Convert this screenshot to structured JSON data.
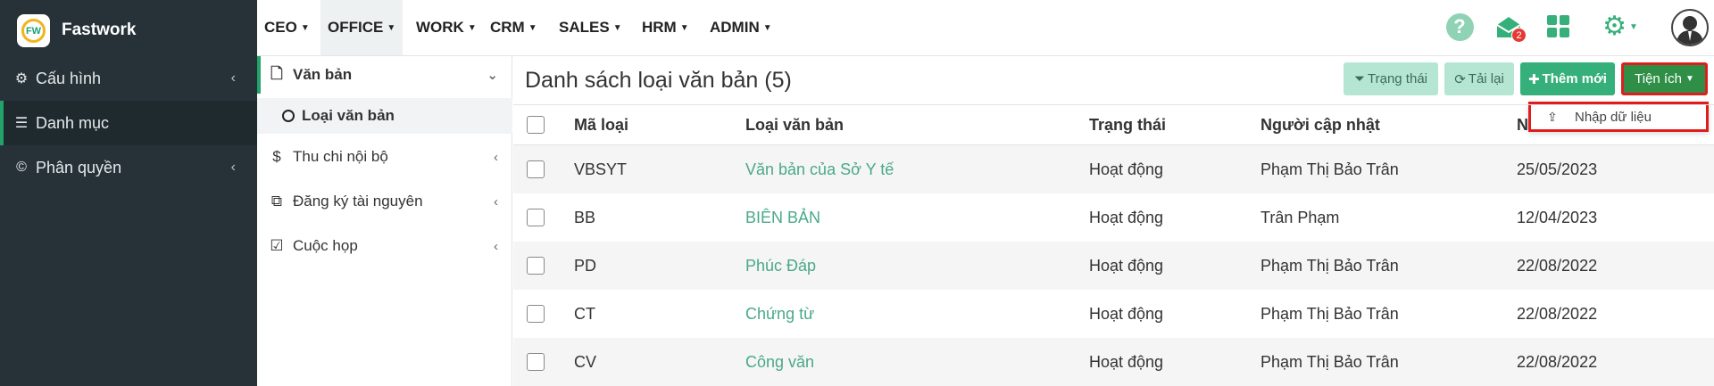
{
  "brand": {
    "name": "Fastwork",
    "logo_text": "FW"
  },
  "sidebar": {
    "items": [
      {
        "label": "Cấu hình",
        "icon": "gear-icon",
        "chevron": "‹"
      },
      {
        "label": "Danh mục",
        "icon": "list-icon"
      },
      {
        "label": "Phân quyền",
        "icon": "copyright-icon",
        "chevron": "‹"
      }
    ]
  },
  "topnav": {
    "items": [
      "CEO",
      "OFFICE",
      "WORK",
      "CRM",
      "SALES",
      "HRM",
      "ADMIN"
    ],
    "active": "OFFICE",
    "notification_count": "2"
  },
  "subnav": {
    "items": [
      {
        "label": "Văn bản",
        "icon": "document-icon"
      },
      {
        "label": "Loại văn bản"
      },
      {
        "label": "Thu chi nội bộ",
        "icon": "dollar-icon"
      },
      {
        "label": "Đăng ký tài nguyên",
        "icon": "cubes-icon"
      },
      {
        "label": "Cuộc họp",
        "icon": "calendar-check-icon"
      }
    ]
  },
  "main": {
    "title": "Danh sách loại văn bản (5)",
    "buttons": {
      "status": "Trạng thái",
      "reload": "Tải lại",
      "add": "Thêm mới",
      "utilities": "Tiện ích"
    },
    "dropdown": {
      "import": "Nhập dữ liệu"
    },
    "table": {
      "headers": [
        "Mã loại",
        "Loại văn bản",
        "Trạng thái",
        "Người cập nhật",
        "N"
      ],
      "rows": [
        [
          "VBSYT",
          "Văn bản của Sở Y tế",
          "Hoạt động",
          "Phạm Thị Bảo Trân",
          "25/05/2023"
        ],
        [
          "BB",
          "BIÊN BẢN",
          "Hoạt động",
          "Trân Phạm",
          "12/04/2023"
        ],
        [
          "PD",
          "Phúc Đáp",
          "Hoạt động",
          "Phạm Thị Bảo Trân",
          "22/08/2022"
        ],
        [
          "CT",
          "Chứng từ",
          "Hoạt động",
          "Phạm Thị Bảo Trân",
          "22/08/2022"
        ],
        [
          "CV",
          "Công văn",
          "Hoạt động",
          "Phạm Thị Bảo Trân",
          "22/08/2022"
        ]
      ]
    }
  },
  "colors": {
    "accent": "#36b07a",
    "sidebar_bg": "#263238",
    "link": "#4aa88b",
    "highlight": "#e01d1d"
  }
}
